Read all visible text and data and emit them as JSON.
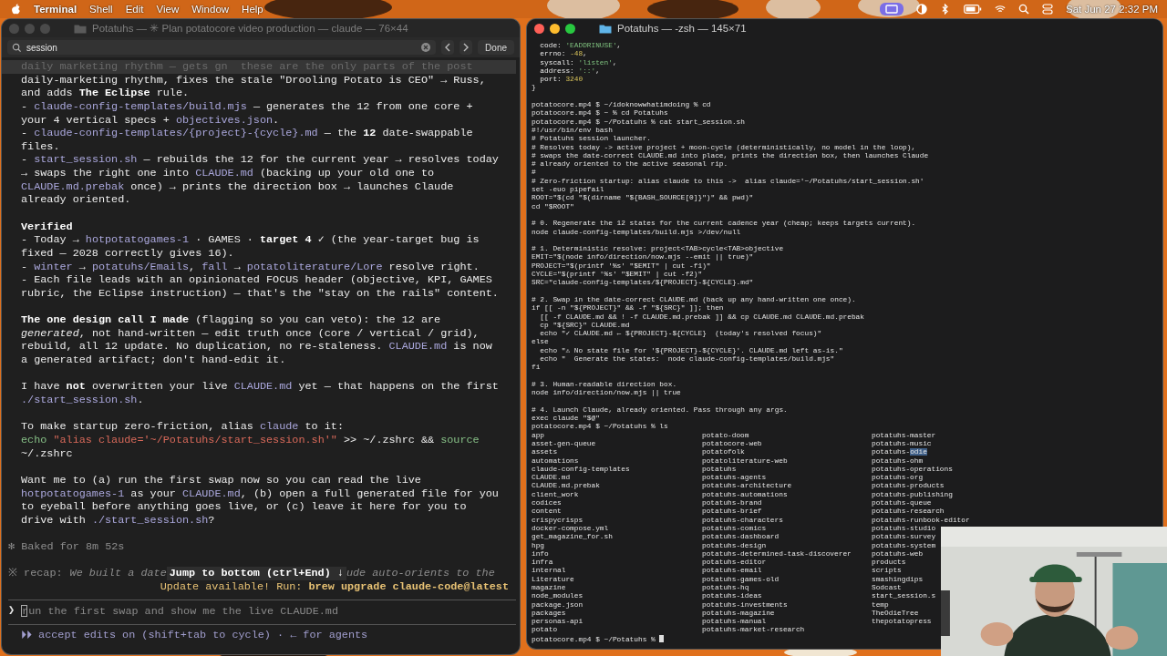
{
  "menu_bar": {
    "app": "Terminal",
    "items": [
      "Shell",
      "Edit",
      "View",
      "Window",
      "Help"
    ],
    "clock": "Sat Jun 27 2:32 PM"
  },
  "left_window": {
    "active": false,
    "title": "Potatuhs — ✳ Plan potatocore video production — claude — 76×44",
    "find": {
      "value": "session",
      "done": "Done"
    },
    "lines": [
      {
        "kind": "faded",
        "spans": [
          {
            "kind": "dim",
            "text": "daily marketing rhythm — gets gn  these are the only parts of the post"
          }
        ]
      },
      {
        "kind": "body",
        "spans": [
          {
            "kind": "plain",
            "text": "daily-marketing rhythm, fixes the stale \"Drooling Potato is CEO\" → Russ,"
          }
        ]
      },
      {
        "kind": "body",
        "spans": [
          {
            "kind": "plain",
            "text": "and adds "
          },
          {
            "kind": "bold",
            "text": "The Eclipse"
          },
          {
            "kind": "plain",
            "text": " rule."
          }
        ]
      },
      {
        "kind": "body",
        "spans": [
          {
            "kind": "plain",
            "text": "- "
          },
          {
            "kind": "code",
            "text": "claude-config-templates/build.mjs"
          },
          {
            "kind": "plain",
            "text": " — generates the 12 from one core +"
          }
        ]
      },
      {
        "kind": "body",
        "spans": [
          {
            "kind": "plain",
            "text": "your 4 vertical specs + "
          },
          {
            "kind": "code",
            "text": "objectives.json"
          },
          {
            "kind": "plain",
            "text": "."
          }
        ]
      },
      {
        "kind": "body",
        "spans": [
          {
            "kind": "plain",
            "text": "- "
          },
          {
            "kind": "code",
            "text": "claude-config-templates/{project}-{cycle}.md"
          },
          {
            "kind": "plain",
            "text": " — the "
          },
          {
            "kind": "bold",
            "text": "12"
          },
          {
            "kind": "plain",
            "text": " date-swappable"
          }
        ]
      },
      {
        "kind": "body",
        "spans": [
          {
            "kind": "plain",
            "text": "files."
          }
        ]
      },
      {
        "kind": "body",
        "spans": [
          {
            "kind": "plain",
            "text": "- "
          },
          {
            "kind": "code",
            "text": "start_session.sh"
          },
          {
            "kind": "plain",
            "text": " — rebuilds the 12 for the current year → resolves today"
          }
        ]
      },
      {
        "kind": "body",
        "spans": [
          {
            "kind": "plain",
            "text": "→ swaps the right one into "
          },
          {
            "kind": "code",
            "text": "CLAUDE.md"
          },
          {
            "kind": "plain",
            "text": " (backing up your old one to"
          }
        ]
      },
      {
        "kind": "body",
        "spans": [
          {
            "kind": "code",
            "text": "CLAUDE.md.prebak"
          },
          {
            "kind": "plain",
            "text": " once) → prints the direction box → launches Claude"
          }
        ]
      },
      {
        "kind": "body",
        "spans": [
          {
            "kind": "plain",
            "text": "already oriented."
          }
        ]
      },
      {
        "kind": "blank"
      },
      {
        "kind": "body",
        "spans": [
          {
            "kind": "bold",
            "text": "Verified"
          }
        ]
      },
      {
        "kind": "body",
        "spans": [
          {
            "kind": "plain",
            "text": "- Today → "
          },
          {
            "kind": "code",
            "text": "hotpotatogames-1"
          },
          {
            "kind": "plain",
            "text": " · GAMES · "
          },
          {
            "kind": "bold",
            "text": "target 4"
          },
          {
            "kind": "plain",
            "text": " ✓ (the year-target bug is"
          }
        ]
      },
      {
        "kind": "body",
        "spans": [
          {
            "kind": "plain",
            "text": "fixed — 2028 correctly gives 16)."
          }
        ]
      },
      {
        "kind": "body",
        "spans": [
          {
            "kind": "plain",
            "text": "- "
          },
          {
            "kind": "code",
            "text": "winter"
          },
          {
            "kind": "plain",
            "text": " → "
          },
          {
            "kind": "code",
            "text": "potatuhs/Emails"
          },
          {
            "kind": "plain",
            "text": ", "
          },
          {
            "kind": "code",
            "text": "fall"
          },
          {
            "kind": "plain",
            "text": " → "
          },
          {
            "kind": "code",
            "text": "potatoliterature/Lore"
          },
          {
            "kind": "plain",
            "text": " resolve right."
          }
        ]
      },
      {
        "kind": "body",
        "spans": [
          {
            "kind": "plain",
            "text": "- Each file leads with an opinionated FOCUS header (objective, KPI, GAMES"
          }
        ]
      },
      {
        "kind": "body",
        "spans": [
          {
            "kind": "plain",
            "text": "rubric, the Eclipse instruction) — that's the \"stay on the rails\" content."
          }
        ]
      },
      {
        "kind": "blank"
      },
      {
        "kind": "body",
        "spans": [
          {
            "kind": "bold",
            "text": "The one design call I made"
          },
          {
            "kind": "plain",
            "text": " (flagging so you can veto): the 12 are"
          }
        ]
      },
      {
        "kind": "body",
        "spans": [
          {
            "kind": "italic",
            "text": "generated"
          },
          {
            "kind": "plain",
            "text": ", not hand-written — edit truth once (core / vertical / grid),"
          }
        ]
      },
      {
        "kind": "body",
        "spans": [
          {
            "kind": "plain",
            "text": "rebuild, all 12 update. No duplication, no re-staleness. "
          },
          {
            "kind": "code",
            "text": "CLAUDE.md"
          },
          {
            "kind": "plain",
            "text": " is now"
          }
        ]
      },
      {
        "kind": "body",
        "spans": [
          {
            "kind": "plain",
            "text": "a generated artifact; don't hand-edit it."
          }
        ]
      },
      {
        "kind": "blank"
      },
      {
        "kind": "body",
        "spans": [
          {
            "kind": "plain",
            "text": "I have "
          },
          {
            "kind": "bold",
            "text": "not"
          },
          {
            "kind": "plain",
            "text": " overwritten your live "
          },
          {
            "kind": "code",
            "text": "CLAUDE.md"
          },
          {
            "kind": "plain",
            "text": " yet — that happens on the first"
          }
        ]
      },
      {
        "kind": "body",
        "spans": [
          {
            "kind": "code",
            "text": "./start_session.sh"
          },
          {
            "kind": "plain",
            "text": "."
          }
        ]
      },
      {
        "kind": "blank"
      },
      {
        "kind": "body",
        "spans": [
          {
            "kind": "plain",
            "text": "To make startup zero-friction, alias "
          },
          {
            "kind": "code",
            "text": "claude"
          },
          {
            "kind": "plain",
            "text": " to it:"
          }
        ]
      },
      {
        "kind": "body",
        "spans": [
          {
            "kind": "command",
            "text": "echo"
          },
          {
            "kind": "string",
            "text": " \"alias claude='~/Potatuhs/start_session.sh'\""
          },
          {
            "kind": "plain",
            "text": " >> ~/.zshrc && "
          },
          {
            "kind": "command",
            "text": "source"
          }
        ]
      },
      {
        "kind": "body",
        "spans": [
          {
            "kind": "plain",
            "text": "~/.zshrc"
          }
        ]
      },
      {
        "kind": "blank"
      },
      {
        "kind": "body",
        "spans": [
          {
            "kind": "plain",
            "text": "Want me to (a) run the first swap now so you can read the live"
          }
        ]
      },
      {
        "kind": "body",
        "spans": [
          {
            "kind": "code",
            "text": "hotpotatogames-1"
          },
          {
            "kind": "plain",
            "text": " as your "
          },
          {
            "kind": "code",
            "text": "CLAUDE.md"
          },
          {
            "kind": "plain",
            "text": ", (b) open a full generated file for you"
          }
        ]
      },
      {
        "kind": "body",
        "spans": [
          {
            "kind": "plain",
            "text": "to eyeball before anything goes live, or (c) leave it here for you to"
          }
        ]
      },
      {
        "kind": "body",
        "spans": [
          {
            "kind": "plain",
            "text": "drive with "
          },
          {
            "kind": "code",
            "text": "./start_session.sh"
          },
          {
            "kind": "plain",
            "text": "?"
          }
        ]
      },
      {
        "kind": "blank"
      },
      {
        "kind": "status",
        "spans": [
          {
            "kind": "dim",
            "text": "✻ Baked for 8m 52s"
          }
        ]
      },
      {
        "kind": "blank"
      }
    ],
    "recap": {
      "label": "※ recap:",
      "before": "We built a date",
      "after": "ude auto-orients to the"
    },
    "jump_button": "Jump to bottom (ctrl+End) ↓",
    "update": [
      {
        "kind": "warn",
        "text": "Update available! Run: "
      },
      {
        "kind": "warnbold",
        "text": "brew upgrade claude-code@latest"
      }
    ],
    "prompt": {
      "symbol": "❯",
      "placeholder": "run the first swap and show me the live CLAUDE.md"
    },
    "mode_line": "⏵⏵ accept edits on (shift+tab to cycle) · ← for agents"
  },
  "right_window": {
    "active": true,
    "title": "Potatuhs — -zsh — 145×71",
    "lines": [
      {
        "kind": "spans",
        "spans": [
          {
            "kind": "plain",
            "text": "  code: "
          },
          {
            "kind": "string",
            "text": "'EADDRINUSE'"
          },
          {
            "kind": "plain",
            "text": ","
          }
        ]
      },
      {
        "kind": "spans",
        "spans": [
          {
            "kind": "plain",
            "text": "  errno: "
          },
          {
            "kind": "number",
            "text": "-48"
          },
          {
            "kind": "plain",
            "text": ","
          }
        ]
      },
      {
        "kind": "spans",
        "spans": [
          {
            "kind": "plain",
            "text": "  syscall: "
          },
          {
            "kind": "string",
            "text": "'listen'"
          },
          {
            "kind": "plain",
            "text": ","
          }
        ]
      },
      {
        "kind": "spans",
        "spans": [
          {
            "kind": "plain",
            "text": "  address: "
          },
          {
            "kind": "string",
            "text": "'::'"
          },
          {
            "kind": "plain",
            "text": ","
          }
        ]
      },
      {
        "kind": "spans",
        "spans": [
          {
            "kind": "plain",
            "text": "  port: "
          },
          {
            "kind": "number",
            "text": "3240"
          }
        ]
      },
      "}",
      {
        "kind": "blank"
      },
      "potatocore.mp4 $ ~/idoknowwhatimdoing % cd",
      "potatocore.mp4 $ ~ % cd Potatuhs",
      "potatocore.mp4 $ ~/Potatuhs % cat start_session.sh",
      "#!/usr/bin/env bash",
      "# Potatuhs session launcher.",
      "# Resolves today -> active project + moon-cycle (deterministically, no model in the loop),",
      "# swaps the date-correct CLAUDE.md into place, prints the direction box, then launches Claude",
      "# already oriented to the active seasonal rip.",
      "#",
      "# Zero-friction startup: alias claude to this ->  alias claude='~/Potatuhs/start_session.sh'",
      "set -euo pipefail",
      "ROOT=\"$(cd \"$(dirname \"${BASH_SOURCE[0]}\")\" && pwd)\"",
      "cd \"$ROOT\"",
      {
        "kind": "blank"
      },
      "# 0. Regenerate the 12 states for the current cadence year (cheap; keeps targets current).",
      "node claude-config-templates/build.mjs >/dev/null",
      {
        "kind": "blank"
      },
      "# 1. Deterministic resolve: project<TAB>cycle<TAB>objective",
      "EMIT=\"$(node info/direction/now.mjs --emit || true)\"",
      "PROJECT=\"$(printf '%s' \"$EMIT\" | cut -f1)\"",
      "CYCLE=\"$(printf '%s' \"$EMIT\" | cut -f2)\"",
      "SRC=\"claude-config-templates/${PROJECT}-${CYCLE}.md\"",
      {
        "kind": "blank"
      },
      "# 2. Swap in the date-correct CLAUDE.md (back up any hand-written one once).",
      "if [[ -n \"${PROJECT}\" && -f \"${SRC}\" ]]; then",
      "  [[ -f CLAUDE.md && ! -f CLAUDE.md.prebak ]] && cp CLAUDE.md CLAUDE.md.prebak",
      "  cp \"${SRC}\" CLAUDE.md",
      "  echo \"✓ CLAUDE.md ← ${PROJECT}-${CYCLE}  (today's resolved focus)\"",
      "else",
      "  echo \"⚠ No state file for '${PROJECT}-${CYCLE}'. CLAUDE.md left as-is.\"",
      "  echo \"  Generate the states:  node claude-config-templates/build.mjs\"",
      "fi",
      {
        "kind": "blank"
      },
      "# 3. Human-readable direction box.",
      "node info/direction/now.mjs || true",
      {
        "kind": "blank"
      },
      "# 4. Launch Claude, already oriented. Pass through any args.",
      "exec claude \"$@\"",
      "potatocore.mp4 $ ~/Potatuhs % ls"
    ],
    "listing": [
      [
        "app",
        "asset-gen-queue",
        "assets",
        "automations",
        "claude-config-templates",
        "CLAUDE.md",
        "CLAUDE.md.prebak",
        "client_work",
        "codices",
        "content",
        "crispycrisps",
        "docker-compose.yml",
        "get_magazine_for.sh",
        "hpg",
        "info",
        "infra",
        "internal",
        "Literature",
        "magazine",
        "node_modules",
        "package.json",
        "packages",
        "personas-api",
        "potato"
      ],
      [
        "potato-doom",
        "potatocore-web",
        "potatofolk",
        "potatoliterature-web",
        "potatuhs",
        "potatuhs-agents",
        "potatuhs-architecture",
        "potatuhs-automations",
        "potatuhs-brand",
        "potatuhs-brief",
        "potatuhs-characters",
        "potatuhs-comics",
        "potatuhs-dashboard",
        "potatuhs-design",
        "potatuhs-determined-task-discoverer",
        "potatuhs-editor",
        "potatuhs-email",
        "potatuhs-games-old",
        "potatuhs-hq",
        "potatuhs-ideas",
        "potatuhs-investments",
        "potatuhs-magazine",
        "potatuhs-manual",
        "potatuhs-market-research"
      ],
      [
        "potatuhs-master",
        "potatuhs-music",
        {
          "text": "potatuhs-",
          "selected_text": "odie"
        },
        "potatuhs-ohm",
        "potatuhs-operations",
        "potatuhs-org",
        "potatuhs-products",
        "potatuhs-publishing",
        "potatuhs-queue",
        "potatuhs-research",
        "potatuhs-runbook-editor",
        "potatuhs-studio",
        "potatuhs-survey",
        "potatuhs-system",
        "potatuhs-web",
        "products",
        "scripts",
        "smashingdips",
        "Sodcast",
        "start_session.s",
        "temp",
        "TheOdieTree",
        "thepotatopress"
      ]
    ],
    "prompt_line": "potatocore.mp4 $ ~/Potatuhs % "
  }
}
